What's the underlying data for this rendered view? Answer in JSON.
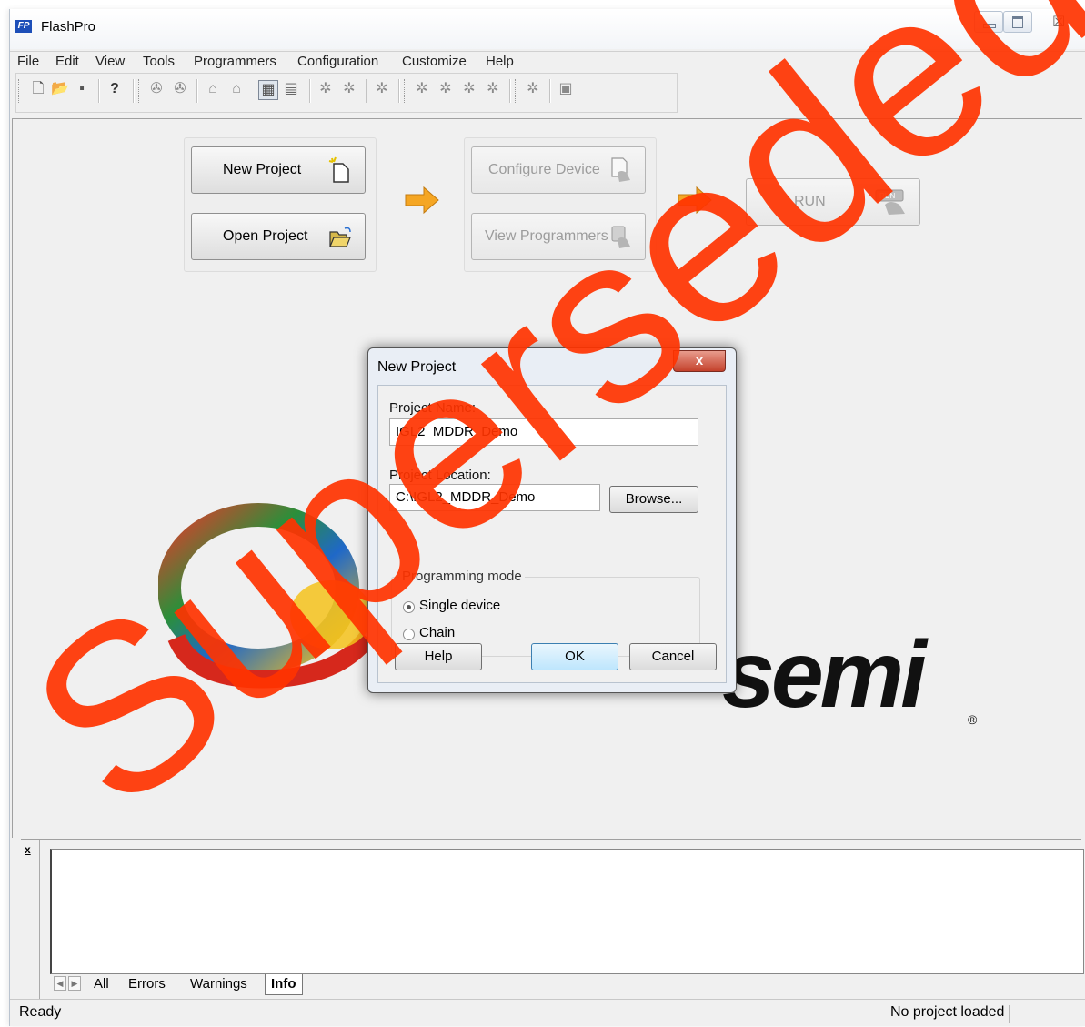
{
  "window": {
    "title": "FlashPro",
    "app_icon_text": "FP"
  },
  "menu": [
    "File",
    "Edit",
    "View",
    "Tools",
    "Programmers",
    "Configuration",
    "Customize",
    "Help"
  ],
  "workflow": {
    "new_project": "New Project",
    "open_project": "Open Project",
    "configure_device": "Configure Device",
    "view_programmers": "View Programmers",
    "run": "RUN",
    "run_icon_text": "RUN"
  },
  "logo": {
    "text": "semi",
    "registered": "®"
  },
  "dialog": {
    "title": "New Project",
    "close": "x",
    "project_name_label": "Project Name:",
    "project_name_value": "IGL2_MDDR_Demo",
    "project_location_label": "Project Location:",
    "project_location_value": "C:\\IGL2_MDDR_Demo",
    "browse": "Browse...",
    "programming_mode_label": "Programming mode",
    "single_device": "Single device",
    "chain": "Chain",
    "selected_mode": "Single device",
    "help": "Help",
    "ok": "OK",
    "cancel": "Cancel"
  },
  "log": {
    "close": "x",
    "tabs": [
      "All",
      "Errors",
      "Warnings",
      "Info"
    ],
    "active_tab": "Info"
  },
  "status": {
    "left": "Ready",
    "right": "No project loaded"
  },
  "watermark": {
    "text": "Superseded",
    "color": "#ff3300"
  },
  "colors": {
    "arrow": "#f5a623",
    "dialog_close": "#c4412b"
  }
}
